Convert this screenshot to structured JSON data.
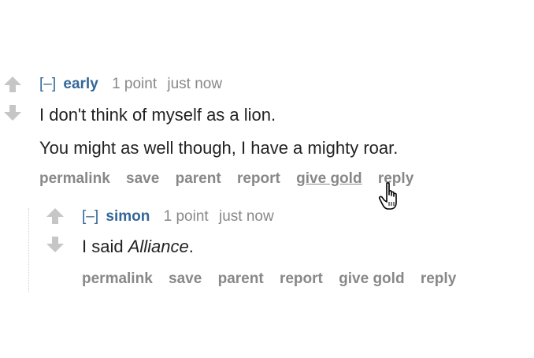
{
  "comments": [
    {
      "collapse": "[–]",
      "author": "early",
      "score": "1 point",
      "time": "just now",
      "body": [
        "I don't think of myself as a lion.",
        "You might as well though, I have a mighty roar."
      ],
      "buttons": [
        "permalink",
        "save",
        "parent",
        "report",
        "give gold",
        "reply"
      ]
    },
    {
      "collapse": "[–]",
      "author": "simon",
      "score": "1 point",
      "time": "just now",
      "body_prefix": "I said ",
      "body_em": "Alliance",
      "body_suffix": ".",
      "buttons": [
        "permalink",
        "save",
        "parent",
        "report",
        "give gold",
        "reply"
      ]
    }
  ],
  "colors": {
    "link": "#336699",
    "muted": "#888888",
    "text": "#222222"
  },
  "icons": [
    "upvote-arrow-icon",
    "downvote-arrow-icon",
    "hand-pointer-cursor-icon"
  ]
}
